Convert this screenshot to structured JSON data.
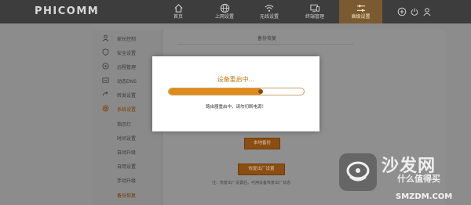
{
  "brand": {
    "name": "PHICOMM"
  },
  "nav": {
    "items": [
      {
        "label": "首页",
        "icon": "home-icon"
      },
      {
        "label": "上网设置",
        "icon": "globe-icon"
      },
      {
        "label": "无线设置",
        "icon": "wifi-icon"
      },
      {
        "label": "终端管理",
        "icon": "devices-icon"
      },
      {
        "label": "高级设置",
        "icon": "sliders-icon",
        "active": true
      }
    ],
    "right_icons": [
      "add-icon",
      "power-icon",
      "user-icon"
    ]
  },
  "sidebar": {
    "items": [
      {
        "label": "家长控制",
        "icon": "user-icon"
      },
      {
        "label": "安全设置",
        "icon": "shield-icon"
      },
      {
        "label": "远程管理",
        "icon": "remote-icon"
      },
      {
        "label": "动态DNS",
        "icon": "dns-icon"
      },
      {
        "label": "转发设置",
        "icon": "forward-icon"
      },
      {
        "label": "系统设置",
        "icon": "gear-icon",
        "expanded": true
      }
    ],
    "subitems": [
      {
        "label": "指示灯"
      },
      {
        "label": "时间设置"
      },
      {
        "label": "自动升级"
      },
      {
        "label": "自用设置"
      },
      {
        "label": "手动升级"
      },
      {
        "label": "备份恢复",
        "current": true
      }
    ]
  },
  "main": {
    "section_title": "备份恢复",
    "backup_button": "本地备份",
    "factory_button": "恢复出厂设置",
    "note": "注：恢复出厂设置后，可用设备恢复出厂状态"
  },
  "modal": {
    "title": "设备重启中...",
    "message": "路由器重启中，请勿切断电源！",
    "progress": 0.68
  },
  "colors": {
    "accent": "#e08c1a",
    "topbar": "#3d3d3d",
    "overlay": "#8c8c8c"
  },
  "watermark": {
    "title": "沙发网",
    "subtitle": "什么值得买",
    "url": "SMZDM.COM"
  }
}
